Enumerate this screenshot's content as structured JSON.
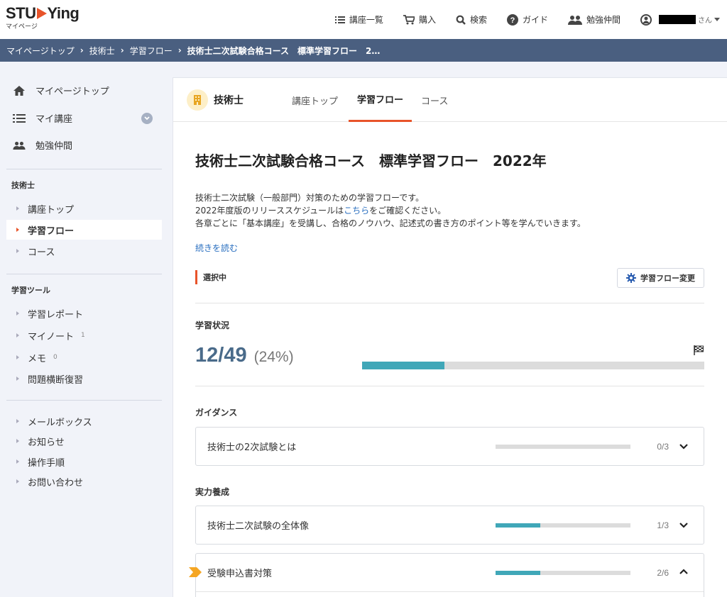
{
  "header": {
    "logo_text_left": "STU",
    "logo_text_right": "Ying",
    "logo_sub": "マイページ",
    "nav": [
      {
        "label": "講座一覧",
        "icon": "list-icon"
      },
      {
        "label": "購入",
        "icon": "cart-icon"
      },
      {
        "label": "検索",
        "icon": "search-icon"
      },
      {
        "label": "ガイド",
        "icon": "help-icon"
      },
      {
        "label": "勉強仲間",
        "icon": "people-icon"
      }
    ],
    "user_suffix": "さん"
  },
  "breadcrumb": [
    "マイページトップ",
    "技術士",
    "学習フロー",
    "技術士二次試験合格コース　標準学習フロー　2…"
  ],
  "sidebar": {
    "top_items": [
      {
        "label": "マイページトップ",
        "icon": "home-icon"
      },
      {
        "label": "マイ講座",
        "icon": "list-icon"
      },
      {
        "label": "勉強仲間",
        "icon": "people-icon"
      }
    ],
    "section1_heading": "技術士",
    "section1_links": [
      {
        "label": "講座トップ"
      },
      {
        "label": "学習フロー"
      },
      {
        "label": "コース"
      }
    ],
    "section2_heading": "学習ツール",
    "section2_links": [
      {
        "label": "学習レポート",
        "count": ""
      },
      {
        "label": "マイノート",
        "count": "1"
      },
      {
        "label": "メモ",
        "count": "0"
      },
      {
        "label": "問題横断復習",
        "count": ""
      }
    ],
    "section3_links": [
      {
        "label": "メールボックス"
      },
      {
        "label": "お知らせ"
      },
      {
        "label": "操作手順"
      },
      {
        "label": "お問い合わせ"
      }
    ]
  },
  "tabs": {
    "brand": "技術士",
    "items": [
      "講座トップ",
      "学習フロー",
      "コース"
    ]
  },
  "main": {
    "title": "技術士二次試験合格コース　標準学習フロー　2022年",
    "desc_line1": "技術士二次試験（一般部門）対策のための学習フローです。",
    "desc_line2_a": "2022年度版のリリーススケジュールは",
    "desc_line2_link": "こちら",
    "desc_line2_b": "をご確認ください。",
    "desc_line3": "各章ごとに「基本講座」を受講し、合格のノウハウ、記述式の書き方のポイント等を学んでいきます。",
    "read_more": "続きを読む",
    "selected_label": "選択中",
    "change_button": "学習フロー変更",
    "status_label": "学習状況",
    "progress_text": "12/49",
    "progress_pct": "(24%)",
    "progress_fraction": 0.24,
    "sections": [
      {
        "label": "ガイダンス",
        "chapters": [
          {
            "name": "技術士の2次試験とは",
            "done": 0,
            "total": 3,
            "count": "0/3",
            "expanded": false
          }
        ]
      },
      {
        "label": "実力養成",
        "chapters": [
          {
            "name": "技術士二次試験の全体像",
            "done": 1,
            "total": 3,
            "count": "1/3",
            "expanded": false
          },
          {
            "name": "受験申込書対策",
            "done": 2,
            "total": 6,
            "count": "2/6",
            "expanded": true,
            "current": true
          }
        ]
      }
    ]
  },
  "colors": {
    "accent": "#e8542a",
    "breadcrumb_bg": "#4a5f80",
    "progress": "#40a7b8",
    "marker": "#f5a623"
  }
}
